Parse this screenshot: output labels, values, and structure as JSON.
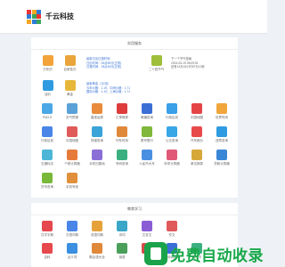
{
  "header": {
    "site_name": "千云科技"
  },
  "section1": {
    "title": "实用服务"
  },
  "row1": {
    "items": [
      {
        "label": "万年历",
        "color": "#f2a33a"
      },
      {
        "label": "百家姓氏",
        "color": "#e9a53b"
      }
    ],
    "date_lines": [
      "最新日出日落时间",
      "日出时间：05点55分(正常)",
      "日落时间：18点45分(正常)"
    ],
    "weather_item": {
      "label": "二十四节气",
      "color": "#9fbe3a"
    },
    "weather_lines": [
      "下一个节气是暑",
      "2024-05-19 08:09:51",
      "还有14天15小时57分13秒"
    ]
  },
  "row2": {
    "items": [
      {
        "label": "油价",
        "color": "#2e9be0"
      },
      {
        "label": "黄金",
        "color": "#e6b73a"
      }
    ],
    "lines": [
      "最新黄金（元/克）",
      "今年价格：1.19，中间价格：1.71",
      "国际价格：1.19，上海价格：1.71"
    ]
  },
  "grid1": [
    {
      "label": "PM2.5",
      "color": "#4aa8e6"
    },
    {
      "label": "天气预报",
      "color": "#5aa1d8"
    },
    {
      "label": "星座运势",
      "color": "#e88b3a"
    },
    {
      "label": "汇率换算",
      "color": "#de3b3b"
    },
    {
      "label": "邮编查询",
      "color": "#3b6fd6"
    },
    {
      "label": "行政区划",
      "color": "#3aa0e8"
    },
    {
      "label": "中国地图",
      "color": "#e54545"
    },
    {
      "label": "世界时间",
      "color": "#f0a63b"
    },
    {
      "label": "行政区划",
      "color": "#4a86e8"
    },
    {
      "label": "中国地图",
      "color": "#e05a5a"
    },
    {
      "label": "快递查询",
      "color": "#3aa3d8"
    },
    {
      "label": "列车时刻",
      "color": "#e0883a"
    },
    {
      "label": "尾号限行",
      "color": "#7fb83a"
    },
    {
      "label": "公交查询",
      "color": "#39a6e6"
    },
    {
      "label": "汽车报价",
      "color": "#e84a4a"
    },
    {
      "label": "违章查询",
      "color": "#2f9be0"
    },
    {
      "label": "交通标志",
      "color": "#4db6d6"
    },
    {
      "label": "个税计算器",
      "color": "#e67a3a"
    },
    {
      "label": "手机归属地",
      "color": "#8a6fd6"
    },
    {
      "label": "号码查询",
      "color": "#3ab080"
    },
    {
      "label": "人民币大写",
      "color": "#4a90e2"
    },
    {
      "label": "科学计算器",
      "color": "#e05a78"
    },
    {
      "label": "单位换算",
      "color": "#d6a83a"
    },
    {
      "label": "贷款计算器",
      "color": "#3a86d6"
    },
    {
      "label": "货币查询",
      "color": "#7ab83a"
    },
    {
      "label": "手机号段",
      "color": "#e0903a"
    }
  ],
  "section2": {
    "title": "教育学习"
  },
  "grid2": [
    {
      "label": "汉字字典",
      "color": "#e5484d"
    },
    {
      "label": "汉语词典",
      "color": "#4a86e8"
    },
    {
      "label": "成语词典",
      "color": "#e6a23a"
    },
    {
      "label": "诗词",
      "color": "#3aa6c8"
    },
    {
      "label": "文言文",
      "color": "#8a5cd6"
    },
    {
      "label": "作文",
      "color": "#e05a5a"
    }
  ],
  "grid2_row2": [
    {
      "label": "百科",
      "color": "#e5484d"
    },
    {
      "label": "近义词",
      "color": "#3a8fe0"
    },
    {
      "label": "歇后语大全",
      "color": "#e0883a"
    },
    {
      "label": "谜语",
      "color": "#4aa05a"
    },
    {
      "label": "对联",
      "color": "#d64a4a"
    },
    {
      "label": "古诗词名句",
      "color": "#3a6fd6"
    },
    {
      "label": "绕口令",
      "color": "#3ab080"
    }
  ],
  "watermark": {
    "text": "免费自动收录"
  }
}
